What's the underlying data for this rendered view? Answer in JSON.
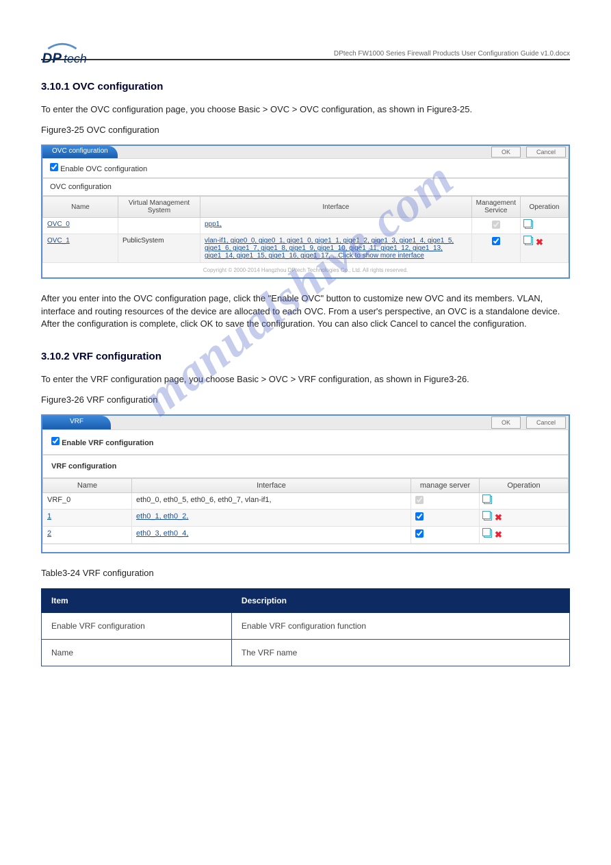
{
  "pageHeader": "DPtech FW1000 Series Firewall Products User Configuration Guide v1.0.docx",
  "s1": {
    "h": "3.10.1 OVC configuration",
    "p1": "To enter the OVC configuration page, you choose Basic > OVC > OVC configuration, as shown in Figure3-25.",
    "figCap": "Figure3-25 OVC configuration",
    "tabTitle": "OVC configuration",
    "ok": "OK",
    "cancel": "Cancel",
    "enableLabel": "Enable OVC configuration",
    "listTitle": "OVC configuration",
    "cols": {
      "name": "Name",
      "vms": "Virtual Management System",
      "iface": "Interface",
      "mgmt": "Management Service",
      "op": "Operation"
    },
    "rows": [
      {
        "name": "OVC_0",
        "vms": "",
        "iface": "ppp1,",
        "mgmt": true,
        "deletable": false
      },
      {
        "name": "OVC_1",
        "vms": "PublicSystem",
        "iface": "vlan-if1, gige0_0, gige0_1, gige1_0, gige1_1, gige1_2, gige1_3, gige1_4, gige1_5, gige1_6, gige1_7, gige1_8, gige1_9, gige1_10, gige1_11, gige1_12, gige1_13, gige1_14, gige1_15, gige1_16, gige1_17, ...Click to show more interface",
        "mgmt": true,
        "deletable": true
      }
    ],
    "copyright": "Copyright © 2000-2014 Hangzhou DPtech Technologies Co., Ltd. All rights reserved.",
    "p2": "After you enter into the OVC configuration page, click the \"Enable OVC\" button to customize new OVC and its members. VLAN, interface and routing resources of the device are allocated to each OVC. From a user's perspective, an OVC is a standalone device. After the configuration is complete, click OK to save the configuration. You can also click Cancel to cancel the configuration."
  },
  "s2": {
    "h": "3.10.2 VRF configuration",
    "p1": "To enter the VRF configuration page, you choose Basic > OVC > VRF configuration, as shown in Figure3-26.",
    "figCap": "Figure3-26 VRF configuration",
    "tabTitle": "VRF",
    "ok": "OK",
    "cancel": "Cancel",
    "enableLabel": "Enable VRF configuration",
    "listTitle": "VRF configuration",
    "cols": {
      "name": "Name",
      "iface": "Interface",
      "mgmt": "manage server",
      "op": "Operation"
    },
    "rows": [
      {
        "name": "VRF_0",
        "iface": "eth0_0, eth0_5, eth0_6, eth0_7, vlan-if1,",
        "mgmt": true,
        "link": false,
        "deletable": false
      },
      {
        "name": "1",
        "iface": "eth0_1, eth0_2,",
        "mgmt": true,
        "link": true,
        "deletable": true
      },
      {
        "name": "2",
        "iface": "eth0_3, eth0_4,",
        "mgmt": true,
        "link": true,
        "deletable": true
      }
    ],
    "tblCap": "Table3-24 VRF configuration",
    "desc": {
      "hItem": "Item",
      "hDesc": "Description",
      "r1i": "Enable VRF configuration",
      "r1d": "Enable VRF configuration function",
      "r2i": "Name",
      "r2d": "The VRF name"
    }
  },
  "watermark": "manualshive.com"
}
